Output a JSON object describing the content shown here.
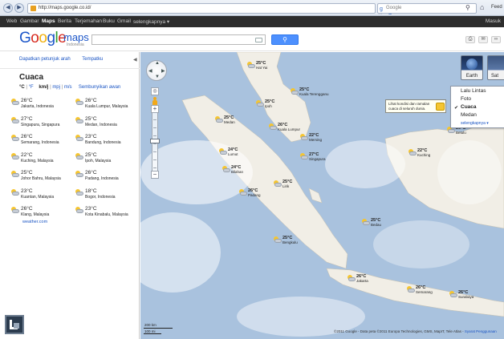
{
  "browser": {
    "url": "http://maps.google.co.id/",
    "search_placeholder": "Google",
    "feed_label": "Feed"
  },
  "gbar": {
    "items": [
      "Web",
      "Gambar",
      "Maps",
      "Berita",
      "Terjemahan",
      "Buku",
      "Gmail",
      "selengkapnya ▾"
    ],
    "active": "Maps",
    "signin": "Masuk"
  },
  "header": {
    "logo_google": "Google",
    "logo_maps": "maps",
    "logo_country": "Indonesia",
    "search_value": "",
    "search_button_icon": "search-icon"
  },
  "panel": {
    "link_directions": "Dapatkan petunjuk arah",
    "link_bookmark": "Tempatku",
    "title": "Cuaca",
    "units": {
      "celsius": "°C",
      "fahrenheit": "°F",
      "kmh": "km/j",
      "mph": "mpj",
      "ms": "m/s",
      "hide_clouds": "Sembunyikan awan"
    },
    "weather": [
      {
        "temp": "26°C",
        "city": "Jakarta, Indonesia"
      },
      {
        "temp": "26°C",
        "city": "Kuala Lumpur, Malaysia"
      },
      {
        "temp": "27°C",
        "city": "Singapura, Singapura"
      },
      {
        "temp": "25°C",
        "city": "Medan, Indonesia"
      },
      {
        "temp": "26°C",
        "city": "Semarang, Indonesia"
      },
      {
        "temp": "23°C",
        "city": "Bandung, Indonesia"
      },
      {
        "temp": "22°C",
        "city": "Kuching, Malaysia"
      },
      {
        "temp": "25°C",
        "city": "Ipoh, Malaysia"
      },
      {
        "temp": "25°C",
        "city": "Johor Bahru, Malaysia"
      },
      {
        "temp": "26°C",
        "city": "Padang, Indonesia"
      },
      {
        "temp": "23°C",
        "city": "Kuantan, Malaysia"
      },
      {
        "temp": "18°C",
        "city": "Bogor, Indonesia"
      },
      {
        "temp": "26°C",
        "city": "Klang, Malaysia"
      },
      {
        "temp": "23°C",
        "city": "Kota Kinabalu, Malaysia"
      }
    ],
    "source": "weather.com"
  },
  "map": {
    "earth_label": "Earth",
    "satellite_label": "Sat",
    "layers": [
      "Lalu Lintas",
      "Foto",
      "Cuaca",
      "Medan"
    ],
    "layer_checked": "Cuaca",
    "layers_more": "selengkapnya ▾",
    "tooltip": "Lihat kondisi dan ramalan cuaca di seluruh dunia.",
    "scale_km": "200 km",
    "scale_mi": "100 mi",
    "copyright": "©2011 Google - Data peta ©2011 Europa Technologies, GMS, MapIT, Tele Atlas -",
    "copyright_link": "Syarat Penggunaan",
    "markers": [
      {
        "temp": "25°C",
        "city": "Hat Yai"
      },
      {
        "temp": "25°C",
        "city": "Kuala Terengganu"
      },
      {
        "temp": "25°C",
        "city": "Ipoh"
      },
      {
        "temp": "25°C",
        "city": "Medan"
      },
      {
        "temp": "26°C",
        "city": "Kuala Lumpur"
      },
      {
        "temp": "22°C",
        "city": "Mersing"
      },
      {
        "temp": "27°C",
        "city": "Singapura"
      },
      {
        "temp": "24°C",
        "city": "Lumut"
      },
      {
        "temp": "24°C",
        "city": "Bilahan"
      },
      {
        "temp": "25°C",
        "city": "Lirik"
      },
      {
        "temp": "26°C",
        "city": "Padang"
      },
      {
        "temp": "22°C",
        "city": "Kuching"
      },
      {
        "temp": "26°C",
        "city": "Betulu"
      },
      {
        "temp": "25°C",
        "city": "Bedau"
      },
      {
        "temp": "25°C",
        "city": "Bengkulu"
      },
      {
        "temp": "26°C",
        "city": "Jakarta"
      },
      {
        "temp": "26°C",
        "city": "Semarang"
      },
      {
        "temp": "26°C",
        "city": "Surabaya"
      }
    ]
  }
}
